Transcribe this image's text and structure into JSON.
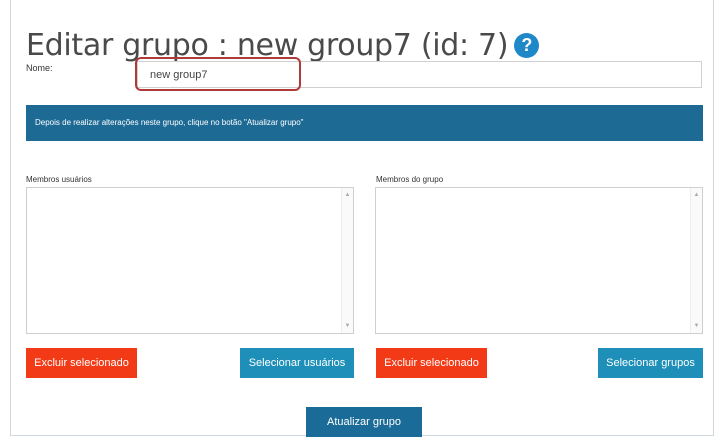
{
  "page": {
    "title": "Editar grupo : new group7 (id: 7)",
    "help_icon": "question-circle-icon",
    "help_symbol": "?"
  },
  "form": {
    "name_label": "Nome:",
    "name_value": "new group7"
  },
  "info": {
    "message": "Depois de realizar alterações neste grupo, clique no botão \"Atualizar grupo\""
  },
  "users_panel": {
    "label": "Membros usuários",
    "remove_button": "Excluir selecionado",
    "select_button": "Selecionar usuários"
  },
  "groups_panel": {
    "label": "Membros do grupo",
    "remove_button": "Excluir selecionado",
    "select_button": "Selecionar grupos"
  },
  "submit": {
    "label": "Atualizar grupo"
  },
  "colors": {
    "danger": "#f23a17",
    "primary": "#1d8fb8",
    "info_bar": "#1d6a95",
    "help": "#1e88c8",
    "highlight": "#b03a3a"
  },
  "icons": {
    "scroll_up": "▲",
    "scroll_down": "▼"
  }
}
